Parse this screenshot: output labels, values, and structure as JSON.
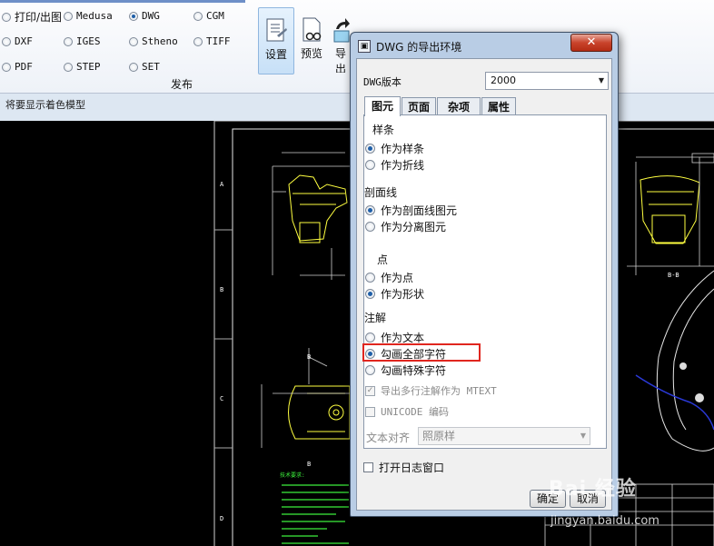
{
  "ribbon": {
    "formats": [
      {
        "label": "打印/出图",
        "selected": false
      },
      {
        "label": "Medusa",
        "selected": false
      },
      {
        "label": "DWG",
        "selected": true
      },
      {
        "label": "CGM",
        "selected": false
      },
      {
        "label": "DXF",
        "selected": false
      },
      {
        "label": "IGES",
        "selected": false
      },
      {
        "label": "Stheno",
        "selected": false
      },
      {
        "label": "TIFF",
        "selected": false
      },
      {
        "label": "PDF",
        "selected": false
      },
      {
        "label": "STEP",
        "selected": false
      },
      {
        "label": "SET",
        "selected": false
      }
    ],
    "group_label": "发布",
    "buttons": {
      "settings": "设置",
      "preview": "预览",
      "export": "导出"
    }
  },
  "status_text": "将要显示着色模型",
  "dialog": {
    "title": "DWG 的导出环境",
    "close_glyph": "✕",
    "version_label": "DWG版本",
    "version_value": "2000",
    "tabs": [
      "图元",
      "页面",
      "杂项",
      "属性"
    ],
    "spline": {
      "title": "样条",
      "options": [
        {
          "label": "作为样条",
          "selected": true
        },
        {
          "label": "作为折线",
          "selected": false
        }
      ]
    },
    "hatch": {
      "title": "剖面线",
      "options": [
        {
          "label": "作为剖面线图元",
          "selected": true
        },
        {
          "label": "作为分离图元",
          "selected": false
        }
      ]
    },
    "point": {
      "title": "点",
      "options": [
        {
          "label": "作为点",
          "selected": false
        },
        {
          "label": "作为形状",
          "selected": true
        }
      ]
    },
    "annotation": {
      "title": "注解",
      "options": [
        {
          "label": "作为文本",
          "selected": false
        },
        {
          "label": "勾画全部字符",
          "selected": true
        },
        {
          "label": "勾画特殊字符",
          "selected": false
        }
      ],
      "mtext_label": "导出多行注解作为 MTEXT",
      "unicode_label": "UNICODE 编码",
      "text_align_label": "文本对齐",
      "text_align_value": "照原样"
    },
    "log_label": "打开日志窗口",
    "ok_label": "确定",
    "cancel_label": "取消"
  },
  "watermark": {
    "line1": "Bai 经验",
    "line2": "jingyan.baidu.com"
  },
  "cad": {
    "zone_letters": [
      "A",
      "B",
      "C",
      "D"
    ],
    "section_label": "B-B",
    "notes_title": "技术要求:"
  }
}
